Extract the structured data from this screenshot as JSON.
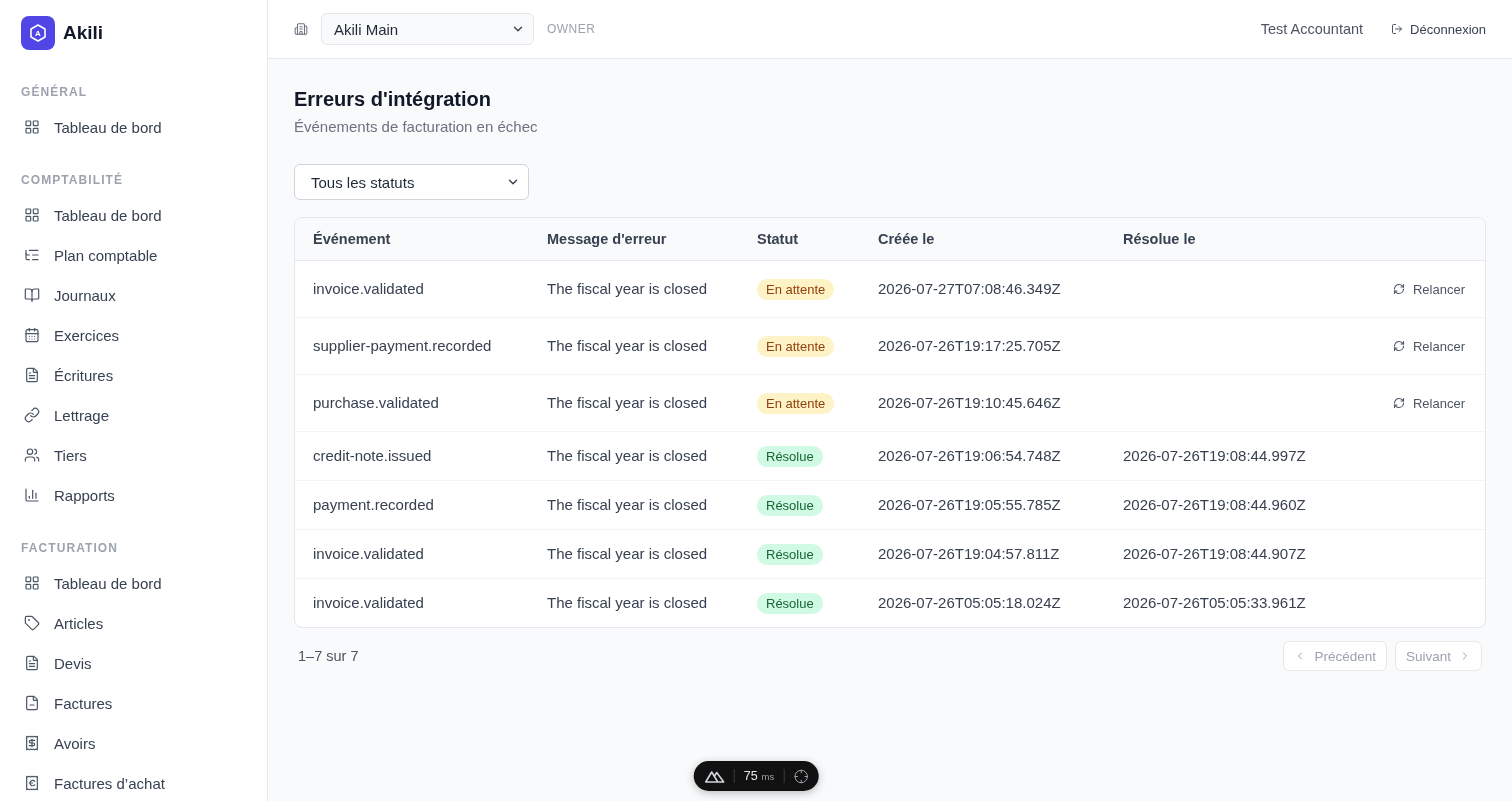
{
  "sidebar": {
    "logo": {
      "mark": "A",
      "name": "Akili"
    },
    "sections": [
      {
        "title": "GÉNÉRAL",
        "items": [
          {
            "label": "Tableau de bord",
            "selected": false
          }
        ]
      },
      {
        "title": "COMPTABILITÉ",
        "items": [
          {
            "label": "Tableau de bord",
            "selected": false
          },
          {
            "label": "Plan comptable",
            "selected": false
          },
          {
            "label": "Journaux",
            "selected": false
          },
          {
            "label": "Exercices",
            "selected": false
          },
          {
            "label": "Écritures",
            "selected": false
          },
          {
            "label": "Lettrage",
            "selected": false
          },
          {
            "label": "Tiers",
            "selected": false
          },
          {
            "label": "Rapports",
            "selected": false
          }
        ]
      },
      {
        "title": "FACTURATION",
        "items": [
          {
            "label": "Tableau de bord",
            "selected": false
          },
          {
            "label": "Articles",
            "selected": false
          },
          {
            "label": "Devis",
            "selected": false
          },
          {
            "label": "Factures",
            "selected": false
          },
          {
            "label": "Avoirs",
            "selected": false
          },
          {
            "label": "Factures d’achat",
            "selected": false
          }
        ]
      }
    ]
  },
  "topbar": {
    "company_select": {
      "value": "Akili Main"
    },
    "role": "OWNER",
    "user": "Test Accountant",
    "logout_button": "Déconnexion"
  },
  "page": {
    "title": "Erreurs d'intégration",
    "subtitle": "Événements de facturation en échec"
  },
  "status_filter": {
    "value": "Tous les statuts"
  },
  "table": {
    "columns": [
      "Événement",
      "Message d'erreur",
      "Statut",
      "Créée le",
      "Résolue le"
    ],
    "rows": [
      {
        "event": "invoice.validated",
        "message": "The fiscal year is closed",
        "status": {
          "kind": "pending",
          "label": "En attente"
        },
        "created": "2026-07-27T07:08:46.349Z",
        "action": "Relancer"
      },
      {
        "event": "supplier-payment.recorded",
        "message": "The fiscal year is closed",
        "status": {
          "kind": "pending",
          "label": "En attente"
        },
        "created": "2026-07-26T19:17:25.705Z",
        "action": "Relancer"
      },
      {
        "event": "purchase.validated",
        "message": "The fiscal year is closed",
        "status": {
          "kind": "pending",
          "label": "En attente"
        },
        "created": "2026-07-26T19:10:45.646Z",
        "action": "Relancer"
      },
      {
        "event": "credit-note.issued",
        "message": "The fiscal year is closed",
        "status": {
          "kind": "resolved",
          "label": "Résolue"
        },
        "created": "2026-07-26T19:06:54.748Z",
        "resolved": "2026-07-26T19:08:44.997Z"
      },
      {
        "event": "payment.recorded",
        "message": "The fiscal year is closed",
        "status": {
          "kind": "resolved",
          "label": "Résolue"
        },
        "created": "2026-07-26T19:05:55.785Z",
        "resolved": "2026-07-26T19:08:44.960Z"
      },
      {
        "event": "invoice.validated",
        "message": "The fiscal year is closed",
        "status": {
          "kind": "resolved",
          "label": "Résolue"
        },
        "created": "2026-07-26T19:04:57.811Z",
        "resolved": "2026-07-26T19:08:44.907Z"
      },
      {
        "event": "invoice.validated",
        "message": "The fiscal year is closed",
        "status": {
          "kind": "resolved",
          "label": "Résolue"
        },
        "created": "2026-07-26T05:05:18.024Z",
        "resolved": "2026-07-26T05:05:33.961Z"
      }
    ]
  },
  "pagination": {
    "summary": "1–7 sur 7",
    "previous": {
      "label": "Précédent",
      "disabled": true
    },
    "next": {
      "label": "Suivant",
      "disabled": true
    }
  },
  "devtools": {
    "value": "75",
    "unit": "ms"
  }
}
